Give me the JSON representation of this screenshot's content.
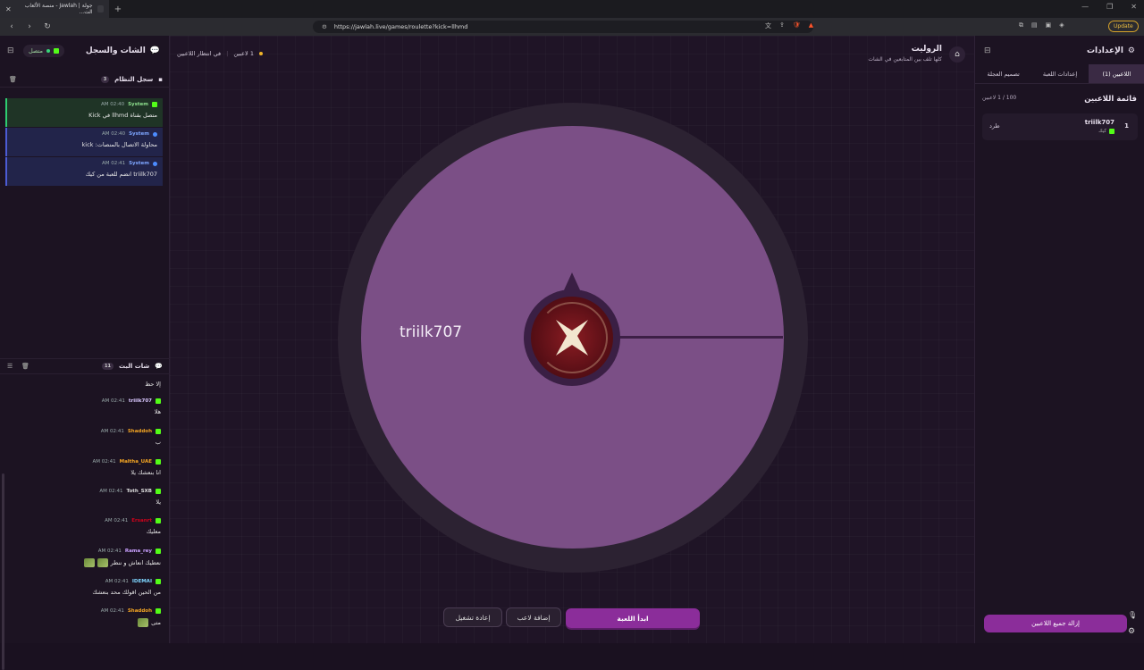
{
  "browser": {
    "tab_title": "جولة | Jawlah - منصة الألعاب الت...",
    "url": "https://jawlah.live/games/roulette?kick=llhmd",
    "update_label": "Update"
  },
  "left_panel": {
    "title": "الشات والسجل",
    "status": "متصل",
    "system_log": {
      "title": "سجل النظام",
      "count": "3",
      "items": [
        {
          "sender": "System",
          "time": "02:40 AM",
          "message": "متصل بقناة llhmd في Kick",
          "variant": "green"
        },
        {
          "sender": "System",
          "time": "02:40 AM",
          "message": "محاولة الاتصال بالمنصات: kick",
          "variant": "blue"
        },
        {
          "sender": "System",
          "time": "02:41 AM",
          "message": "triilk707 انضم للعبة من كيك",
          "variant": "blue"
        }
      ]
    },
    "live_chat": {
      "title": "شات البث",
      "count": "11",
      "items": [
        {
          "user": "",
          "time": "",
          "message": "إلا حظ",
          "color": "#ffffff"
        },
        {
          "user": "triilk707",
          "time": "02:41 AM",
          "message": "هلا",
          "color": "#d9c7ff"
        },
        {
          "user": "Shaddoh",
          "time": "02:41 AM",
          "message": "ب",
          "color": "#f5a623"
        },
        {
          "user": "Maltha_UAE",
          "time": "02:41 AM",
          "message": "انا بنعشك يلا",
          "color": "#f5a623"
        },
        {
          "user": "Toth_SXB",
          "time": "02:41 AM",
          "message": "يلا",
          "color": "#dddddd"
        },
        {
          "user": "Ersanrt",
          "time": "02:41 AM",
          "message": "معليك",
          "color": "#d0021b"
        },
        {
          "user": "Rama_rey",
          "time": "02:41 AM",
          "message": "نعطيك انعاش و ننطر",
          "color": "#c9a0ff"
        },
        {
          "user": "IDEMAI",
          "time": "02:41 AM",
          "message": "من الحين اقولك محد بنعشك",
          "color": "#7ed6ff"
        },
        {
          "user": "Shaddoh",
          "time": "02:41 AM",
          "message": "متى",
          "color": "#f5a623"
        }
      ]
    }
  },
  "center": {
    "title": "الروليت",
    "subtitle": "كلها تلف بين المتابعين في الشات",
    "status_players": "1 لاعبين",
    "status_waiting": "في انتظار اللاعبين",
    "wheel_segment": "triilk707",
    "buttons": {
      "start": "ابدأ اللعبة",
      "add_player": "إضافة لاعب",
      "restart": "إعادة تشغيل"
    }
  },
  "right_panel": {
    "title": "الإعدادات",
    "tabs": [
      "اللاعبين (1)",
      "إعدادات اللعبة",
      "تصميم العجلة"
    ],
    "list_title": "قائمة اللاعبين",
    "list_count": "100 / 1 لاعبين",
    "players": [
      {
        "index": "1",
        "name": "triilk707",
        "platform": "كيك",
        "kick_label": "طرد"
      }
    ],
    "remove_all": "إزالة جميع اللاعبين"
  },
  "colors": {
    "accent": "#8b2d9a",
    "wheel": "#7b4f86",
    "kick_green": "#53fc18"
  }
}
